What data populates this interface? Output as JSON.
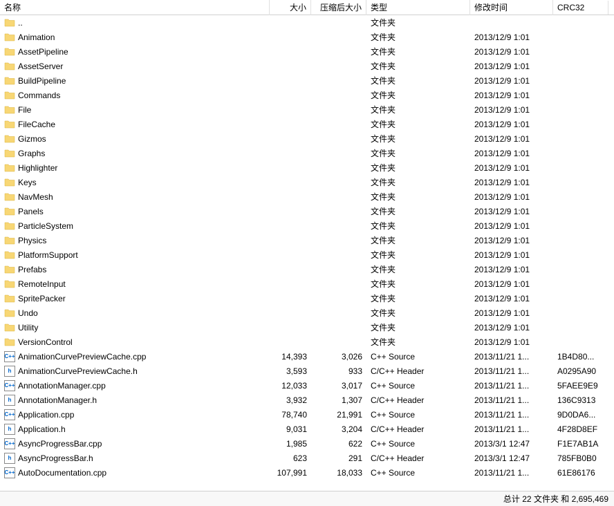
{
  "columns": {
    "name": "名称",
    "size": "大小",
    "compressed": "压缩后大小",
    "type": "类型",
    "modified": "修改时间",
    "crc": "CRC32"
  },
  "folder_type_label": "文件夹",
  "rows": [
    {
      "icon": "folder",
      "name": "..",
      "size": "",
      "compressed": "",
      "type": "文件夹",
      "modified": "",
      "crc": ""
    },
    {
      "icon": "folder",
      "name": "Animation",
      "size": "",
      "compressed": "",
      "type": "文件夹",
      "modified": "2013/12/9 1:01",
      "crc": ""
    },
    {
      "icon": "folder",
      "name": "AssetPipeline",
      "size": "",
      "compressed": "",
      "type": "文件夹",
      "modified": "2013/12/9 1:01",
      "crc": ""
    },
    {
      "icon": "folder",
      "name": "AssetServer",
      "size": "",
      "compressed": "",
      "type": "文件夹",
      "modified": "2013/12/9 1:01",
      "crc": ""
    },
    {
      "icon": "folder",
      "name": "BuildPipeline",
      "size": "",
      "compressed": "",
      "type": "文件夹",
      "modified": "2013/12/9 1:01",
      "crc": ""
    },
    {
      "icon": "folder",
      "name": "Commands",
      "size": "",
      "compressed": "",
      "type": "文件夹",
      "modified": "2013/12/9 1:01",
      "crc": ""
    },
    {
      "icon": "folder",
      "name": "File",
      "size": "",
      "compressed": "",
      "type": "文件夹",
      "modified": "2013/12/9 1:01",
      "crc": ""
    },
    {
      "icon": "folder",
      "name": "FileCache",
      "size": "",
      "compressed": "",
      "type": "文件夹",
      "modified": "2013/12/9 1:01",
      "crc": ""
    },
    {
      "icon": "folder",
      "name": "Gizmos",
      "size": "",
      "compressed": "",
      "type": "文件夹",
      "modified": "2013/12/9 1:01",
      "crc": ""
    },
    {
      "icon": "folder",
      "name": "Graphs",
      "size": "",
      "compressed": "",
      "type": "文件夹",
      "modified": "2013/12/9 1:01",
      "crc": ""
    },
    {
      "icon": "folder",
      "name": "Highlighter",
      "size": "",
      "compressed": "",
      "type": "文件夹",
      "modified": "2013/12/9 1:01",
      "crc": ""
    },
    {
      "icon": "folder",
      "name": "Keys",
      "size": "",
      "compressed": "",
      "type": "文件夹",
      "modified": "2013/12/9 1:01",
      "crc": ""
    },
    {
      "icon": "folder",
      "name": "NavMesh",
      "size": "",
      "compressed": "",
      "type": "文件夹",
      "modified": "2013/12/9 1:01",
      "crc": ""
    },
    {
      "icon": "folder",
      "name": "Panels",
      "size": "",
      "compressed": "",
      "type": "文件夹",
      "modified": "2013/12/9 1:01",
      "crc": ""
    },
    {
      "icon": "folder",
      "name": "ParticleSystem",
      "size": "",
      "compressed": "",
      "type": "文件夹",
      "modified": "2013/12/9 1:01",
      "crc": ""
    },
    {
      "icon": "folder",
      "name": "Physics",
      "size": "",
      "compressed": "",
      "type": "文件夹",
      "modified": "2013/12/9 1:01",
      "crc": ""
    },
    {
      "icon": "folder",
      "name": "PlatformSupport",
      "size": "",
      "compressed": "",
      "type": "文件夹",
      "modified": "2013/12/9 1:01",
      "crc": ""
    },
    {
      "icon": "folder",
      "name": "Prefabs",
      "size": "",
      "compressed": "",
      "type": "文件夹",
      "modified": "2013/12/9 1:01",
      "crc": ""
    },
    {
      "icon": "folder",
      "name": "RemoteInput",
      "size": "",
      "compressed": "",
      "type": "文件夹",
      "modified": "2013/12/9 1:01",
      "crc": ""
    },
    {
      "icon": "folder",
      "name": "SpritePacker",
      "size": "",
      "compressed": "",
      "type": "文件夹",
      "modified": "2013/12/9 1:01",
      "crc": ""
    },
    {
      "icon": "folder",
      "name": "Undo",
      "size": "",
      "compressed": "",
      "type": "文件夹",
      "modified": "2013/12/9 1:01",
      "crc": ""
    },
    {
      "icon": "folder",
      "name": "Utility",
      "size": "",
      "compressed": "",
      "type": "文件夹",
      "modified": "2013/12/9 1:01",
      "crc": ""
    },
    {
      "icon": "folder",
      "name": "VersionControl",
      "size": "",
      "compressed": "",
      "type": "文件夹",
      "modified": "2013/12/9 1:01",
      "crc": ""
    },
    {
      "icon": "cpp",
      "name": "AnimationCurvePreviewCache.cpp",
      "size": "14,393",
      "compressed": "3,026",
      "type": "C++ Source",
      "modified": "2013/11/21 1...",
      "crc": "1B4D80..."
    },
    {
      "icon": "h",
      "name": "AnimationCurvePreviewCache.h",
      "size": "3,593",
      "compressed": "933",
      "type": "C/C++ Header",
      "modified": "2013/11/21 1...",
      "crc": "A0295A90"
    },
    {
      "icon": "cpp",
      "name": "AnnotationManager.cpp",
      "size": "12,033",
      "compressed": "3,017",
      "type": "C++ Source",
      "modified": "2013/11/21 1...",
      "crc": "5FAEE9E9"
    },
    {
      "icon": "h",
      "name": "AnnotationManager.h",
      "size": "3,932",
      "compressed": "1,307",
      "type": "C/C++ Header",
      "modified": "2013/11/21 1...",
      "crc": "136C9313"
    },
    {
      "icon": "cpp",
      "name": "Application.cpp",
      "size": "78,740",
      "compressed": "21,991",
      "type": "C++ Source",
      "modified": "2013/11/21 1...",
      "crc": "9D0DA6..."
    },
    {
      "icon": "h",
      "name": "Application.h",
      "size": "9,031",
      "compressed": "3,204",
      "type": "C/C++ Header",
      "modified": "2013/11/21 1...",
      "crc": "4F28D8EF"
    },
    {
      "icon": "cpp",
      "name": "AsyncProgressBar.cpp",
      "size": "1,985",
      "compressed": "622",
      "type": "C++ Source",
      "modified": "2013/3/1 12:47",
      "crc": "F1E7AB1A"
    },
    {
      "icon": "h",
      "name": "AsyncProgressBar.h",
      "size": "623",
      "compressed": "291",
      "type": "C/C++ Header",
      "modified": "2013/3/1 12:47",
      "crc": "785FB0B0"
    },
    {
      "icon": "cpp",
      "name": "AutoDocumentation.cpp",
      "size": "107,991",
      "compressed": "18,033",
      "type": "C++ Source",
      "modified": "2013/11/21 1...",
      "crc": "61E86176"
    }
  ],
  "status": "总计 22 文件夹 和 2,695,469"
}
